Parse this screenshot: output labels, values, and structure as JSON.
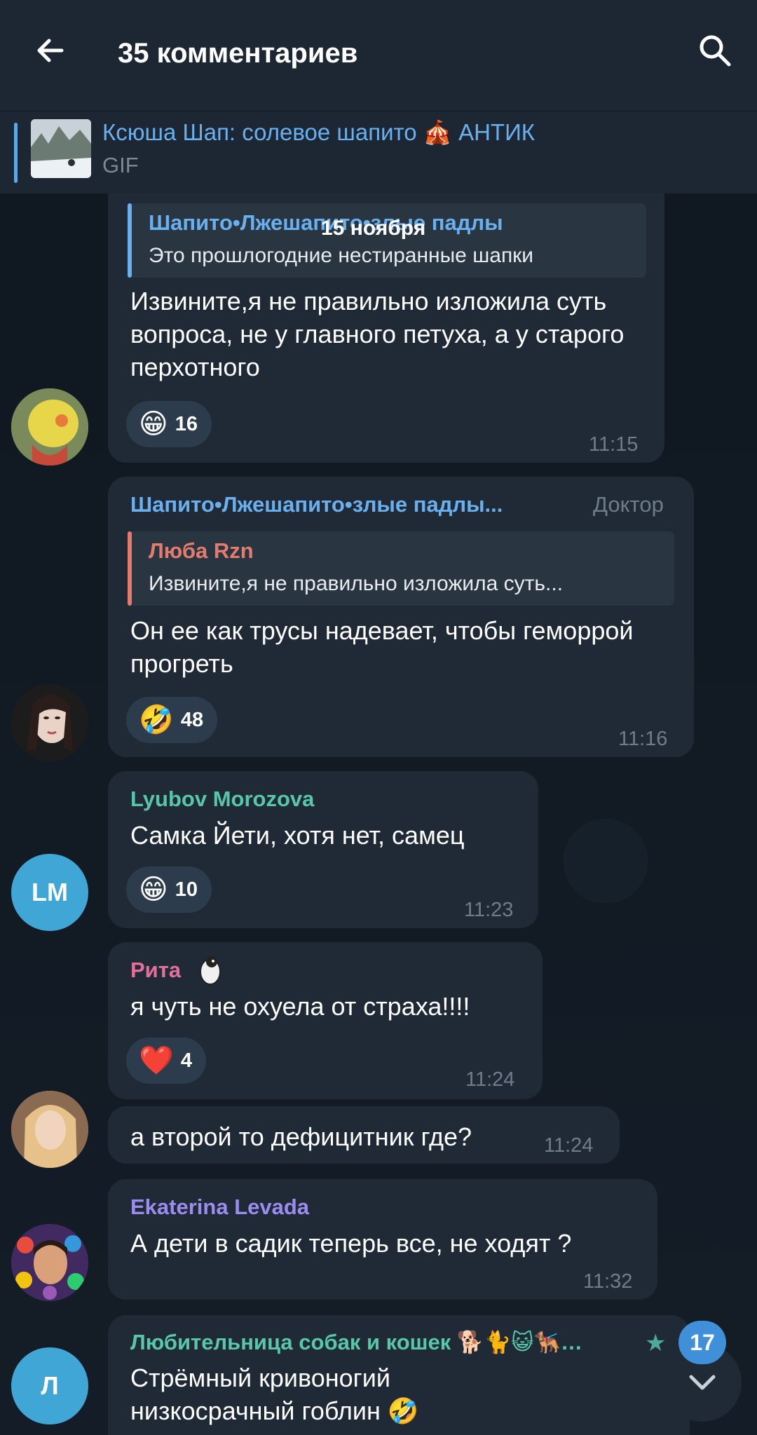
{
  "header": {
    "title": "35 комментариев"
  },
  "pinned": {
    "title": "Ксюша Шап: солевое шапито 🎪 АНТИК",
    "subtitle": "GIF"
  },
  "date_divider": "15 ноября",
  "messages": [
    {
      "reply_name": "Шапито•Лжешапито•злые падлы",
      "reply_text": "Это прошлогодние нестиранные шапки",
      "text": "Извините,я не правильно изложила суть вопроса, не у главного петуха, а у старого перхотного",
      "reaction_emoji": "😁",
      "reaction_count": "16",
      "time": "11:15"
    },
    {
      "sender": "Шапито•Лжешапито•злые падлы...",
      "sender_tag": "Доктор",
      "reply_name": "Люба Rzn",
      "reply_text": "Извините,я не правильно изложила суть...",
      "text": "Он ее как трусы надевает, чтобы геморрой прогреть",
      "reaction_emoji": "🤣",
      "reaction_count": "48",
      "time": "11:16"
    },
    {
      "sender": "Lyubov Morozova",
      "avatar_initials": "LM",
      "text": "Самка Йети, хотя нет, самец",
      "reaction_emoji": "😁",
      "reaction_count": "10",
      "time": "11:23"
    },
    {
      "sender": "Рита",
      "text": "я чуть не охуела от страха!!!!",
      "reaction_emoji": "❤️",
      "reaction_count": "4",
      "time": "11:24"
    },
    {
      "text": "а второй то дефицитник где?",
      "time": "11:24"
    },
    {
      "sender": "Ekaterina Levada",
      "text": "А дети в садик теперь все, не ходят ?",
      "time": "11:32"
    },
    {
      "sender": "Любительница собак и кошек 🐕🐈😺🐕‍🦺…",
      "avatar_initials": "Л",
      "text": "Стрёмный кривоногий низкосрачный гоблин 🤣"
    }
  ],
  "unread_count": "17",
  "colors": {
    "header_bg": "#1c2733",
    "bubble_bg": "#1f2a36",
    "link_blue": "#6ab0ef",
    "reply_red": "#e47c6e",
    "green_name": "#58c7a8",
    "pink_name": "#e46f9b",
    "purple_name": "#9d8cf0",
    "badge_blue": "#3f8fd9"
  }
}
